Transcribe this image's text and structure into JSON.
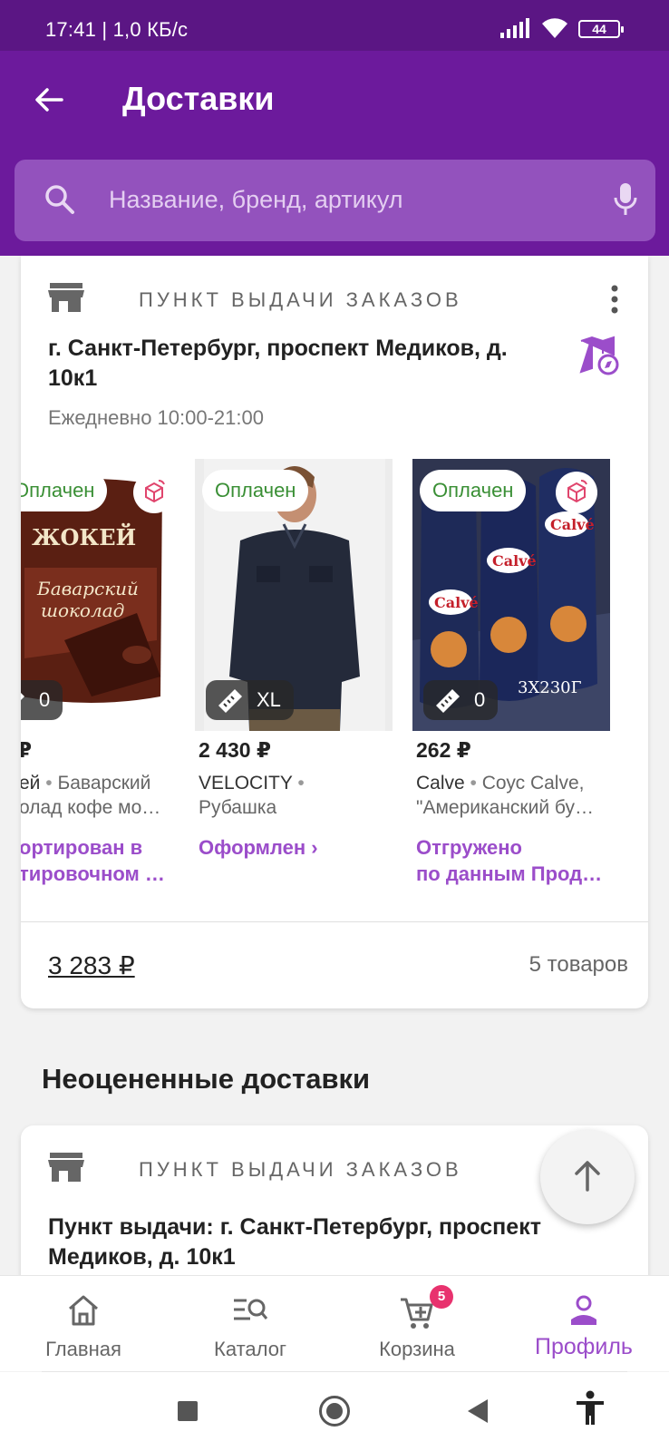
{
  "status_bar": {
    "time": "17:41 | 1,0 КБ/с",
    "battery": "44"
  },
  "app_bar": {
    "title": "Доставки"
  },
  "search": {
    "placeholder": "Название, бренд, артикул"
  },
  "delivery_card": {
    "pickup_label": "ПУНКТ ВЫДАЧИ ЗАКАЗОВ",
    "address": "г. Санкт-Петербург, проспект Медиков, д. 10к1",
    "hours": "Ежедневно 10:00-21:00",
    "products": [
      {
        "status": "Оплачен",
        "size": "0",
        "price": "₽",
        "brand": "ей",
        "name_line1": "Баварский",
        "name_line2": "олад кофе мо…",
        "tracking_line1": "ортирован в",
        "tracking_line2": "тировочном …"
      },
      {
        "status": "Оплачен",
        "size": "XL",
        "price": "2 430 ₽",
        "brand": "VELOCITY",
        "name_line1": "",
        "name_line2": "Рубашка",
        "tracking_line1": "Оформлен ›",
        "tracking_line2": ""
      },
      {
        "status": "Оплачен",
        "size": "0",
        "price": "262 ₽",
        "brand": "Calve",
        "name_line1": "Соус Calve,",
        "name_line2": "\"Американский бу…",
        "tracking_line1": "Отгружено",
        "tracking_line2": "по данным Прод…",
        "pack_label": "3X230Г"
      }
    ],
    "product_text": {
      "chocolate_brand": "ЖОКЕЙ",
      "chocolate_name_1": "Баварский",
      "chocolate_name_2": "шоколад",
      "sauce_brand": "Calvé"
    },
    "total": "3 283 ₽",
    "items_count": "5 товаров"
  },
  "unrated_section": {
    "title": "Неоцененные доставки",
    "pickup_label": "ПУНКТ ВЫДАЧИ ЗАКАЗОВ",
    "address": "Пункт выдачи: г. Санкт-Петербург, проспект Медиков, д. 10к1"
  },
  "bottom_nav": {
    "items": [
      {
        "label": "Главная",
        "icon": "home-icon"
      },
      {
        "label": "Каталог",
        "icon": "catalog-icon"
      },
      {
        "label": "Корзина",
        "icon": "cart-icon",
        "badge": "5"
      },
      {
        "label": "Профиль",
        "icon": "profile-icon",
        "active": true
      }
    ]
  },
  "colors": {
    "brand": "#6c1a9c",
    "accent": "#9b4dca",
    "status_paid": "#3a8f35",
    "badge": "#e8326e"
  }
}
